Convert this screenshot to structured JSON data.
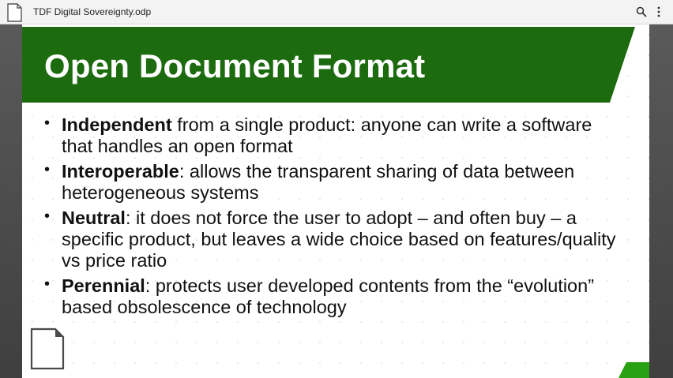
{
  "app": {
    "file_title": "TDF Digital Sovereignty.odp"
  },
  "icons": {
    "doc": "document-icon",
    "search": "search-icon",
    "more": "more-vert-icon",
    "logo": "libreoffice-impress-logo-icon"
  },
  "colors": {
    "banner_green": "#1d6b0f",
    "corner_green": "#2aa014",
    "bg_dark": "#4b4b4b"
  },
  "slide": {
    "title": "Open Document Format",
    "bullets": [
      {
        "bold": "Independent",
        "rest": " from a single product: anyone can write a software that handles an open format"
      },
      {
        "bold": "Interoperable",
        "rest": ": allows the transparent sharing of data between heterogeneous systems"
      },
      {
        "bold": "Neutral",
        "rest": ": it does not force the user to adopt – and often buy – a specific product, but leaves a wide choice based on features/quality vs price ratio"
      },
      {
        "bold": "Perennial",
        "rest": ": protects user developed contents from the “evolution” based obsolescence of technology"
      }
    ],
    "bullet_symbol": "•"
  }
}
